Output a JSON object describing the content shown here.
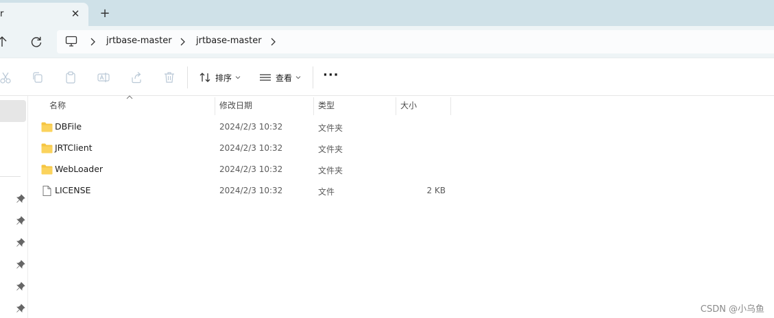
{
  "tab": {
    "title": "r"
  },
  "breadcrumb": [
    "jrtbase-master",
    "jrtbase-master"
  ],
  "commands": {
    "sort_label": "排序",
    "view_label": "查看"
  },
  "columns": {
    "name": "名称",
    "date": "修改日期",
    "type": "类型",
    "size": "大小"
  },
  "files": [
    {
      "name": "DBFile",
      "date": "2024/2/3 10:32",
      "type": "文件夹",
      "size": "",
      "kind": "folder"
    },
    {
      "name": "JRTClient",
      "date": "2024/2/3 10:32",
      "type": "文件夹",
      "size": "",
      "kind": "folder"
    },
    {
      "name": "WebLoader",
      "date": "2024/2/3 10:32",
      "type": "文件夹",
      "size": "",
      "kind": "folder"
    },
    {
      "name": "LICENSE",
      "date": "2024/2/3 10:32",
      "type": "文件",
      "size": "2 KB",
      "kind": "file"
    }
  ],
  "watermark": "CSDN @小乌鱼",
  "colors": {
    "folder": "#f5c542",
    "tabstrip": "#cfe1e8",
    "navbar": "#eef4f6"
  }
}
